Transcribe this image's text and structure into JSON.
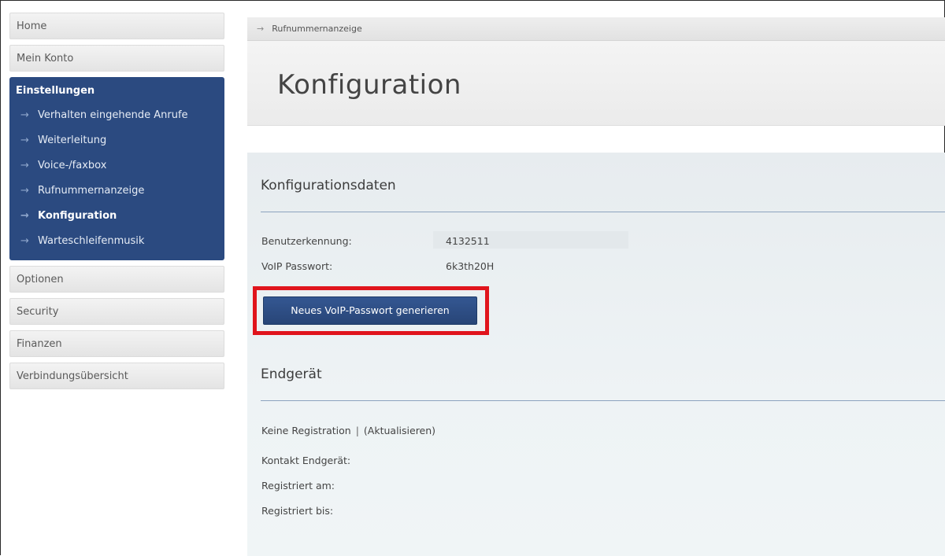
{
  "sidebar": {
    "items_top": [
      "Home",
      "Mein Konto"
    ],
    "group": {
      "title": "Einstellungen",
      "items": [
        {
          "label": "Verhalten eingehende Anrufe",
          "active": false
        },
        {
          "label": "Weiterleitung",
          "active": false
        },
        {
          "label": "Voice-/faxbox",
          "active": false
        },
        {
          "label": "Rufnummernanzeige",
          "active": false
        },
        {
          "label": "Konfiguration",
          "active": true
        },
        {
          "label": "Warteschleifenmusik",
          "active": false
        }
      ]
    },
    "items_bottom": [
      "Optionen",
      "Security",
      "Finanzen",
      "Verbindungsübersicht"
    ]
  },
  "breadcrumb": {
    "label": "Rufnummernanzeige"
  },
  "header": {
    "title": "Konfiguration"
  },
  "config": {
    "title": "Konfigurationsdaten",
    "user_label": "Benutzerkennung:",
    "user_value": "4132511",
    "pass_label": "VoIP Passwort:",
    "pass_value": "6k3th20H",
    "button_label": "Neues VoIP-Passwort generieren"
  },
  "device": {
    "title": "Endgerät",
    "status": "Keine Registration",
    "separator": "|",
    "refresh": "(Aktualisieren)",
    "contact_label": "Kontakt Endgerät:",
    "registered_at_label": "Registriert am:",
    "registered_until_label": "Registriert bis:"
  },
  "colors": {
    "accent": "#2b4a80",
    "highlight": "#e0141c"
  },
  "icons": {
    "nav_arrow": "arrow-right-icon"
  }
}
